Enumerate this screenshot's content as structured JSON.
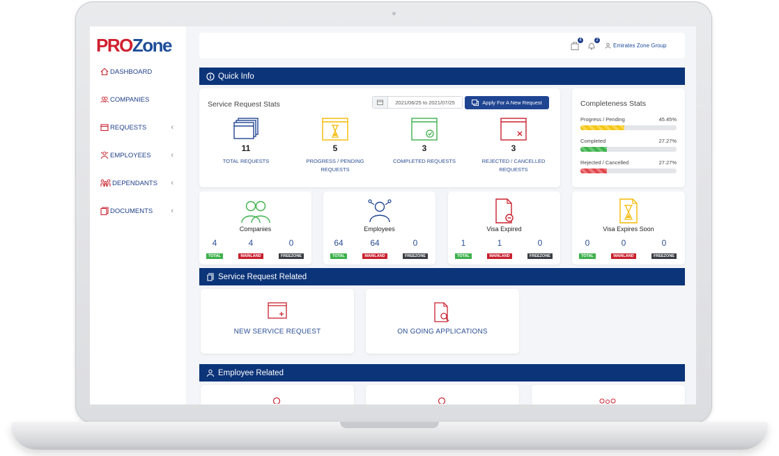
{
  "logo": {
    "pro": "PRO",
    "zone": "Zone"
  },
  "sidebar": {
    "items": [
      {
        "label": "DASHBOARD",
        "icon": "home-icon"
      },
      {
        "label": "COMPANIES",
        "icon": "people-icon"
      },
      {
        "label": "REQUESTS",
        "icon": "window-icon"
      },
      {
        "label": "EMPLOYEES",
        "icon": "employees-icon"
      },
      {
        "label": "DEPENDANTS",
        "icon": "family-icon"
      },
      {
        "label": "DOCUMENTS",
        "icon": "documents-icon"
      }
    ]
  },
  "topbar": {
    "cart_count": "4",
    "notif_count": "2",
    "user": "Emirates Zone Group"
  },
  "quick_info": {
    "title": "Quick Info"
  },
  "service_stats": {
    "title": "Service Request Stats",
    "date_range": "2021/06/25 to 2021/07/25",
    "apply_button": "Apply For A New Request",
    "stats": [
      {
        "value": "11",
        "label": "TOTAL REQUESTS",
        "color": "#1f4592"
      },
      {
        "value": "5",
        "label": "PROGRESS / PENDING REQUESTS",
        "color": "#f5b800"
      },
      {
        "value": "3",
        "label": "COMPLETED REQUESTS",
        "color": "#3db14b"
      },
      {
        "value": "3",
        "label": "REJECTED / CANCELLED REQUESTS",
        "color": "#c8202e"
      }
    ]
  },
  "completeness": {
    "title": "Completeness Stats",
    "rows": [
      {
        "label": "Progress / Pending",
        "value": "45.45%",
        "fraction": 0.4545,
        "style": "yellow"
      },
      {
        "label": "Completed",
        "value": "27.27%",
        "fraction": 0.2727,
        "style": "green"
      },
      {
        "label": "Rejected / Cancelled",
        "value": "27.27%",
        "fraction": 0.2727,
        "style": "red"
      }
    ]
  },
  "summary": [
    {
      "name": "Companies",
      "total": "4",
      "mainland": "4",
      "freezone": "0"
    },
    {
      "name": "Employees",
      "total": "64",
      "mainland": "64",
      "freezone": "0"
    },
    {
      "name": "Visa Expired",
      "total": "1",
      "mainland": "1",
      "freezone": "0"
    },
    {
      "name": "Visa Expires Soon",
      "total": "0",
      "mainland": "0",
      "freezone": "0"
    }
  ],
  "tags": {
    "total": "TOTAL",
    "mainland": "MAINLAND",
    "freezone": "FREEZONE"
  },
  "service_related": {
    "title": "Service Request Related",
    "actions": [
      {
        "label": "NEW SERVICE REQUEST"
      },
      {
        "label": "ON GOING APPLICATIONS"
      }
    ]
  },
  "employee_related": {
    "title": "Employee Related"
  }
}
